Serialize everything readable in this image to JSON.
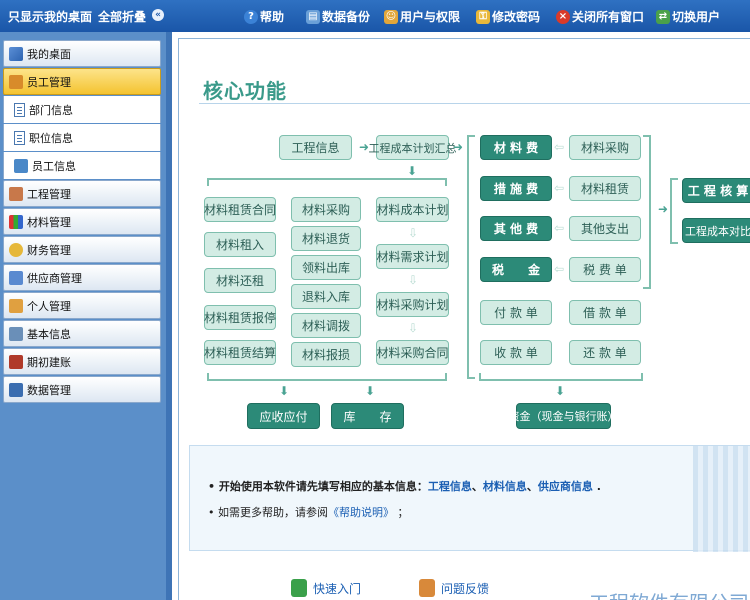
{
  "topbar": {
    "show_desktop": "只显示我的桌面",
    "collapse_all": "全部折叠",
    "help": "帮助",
    "backup": "数据备份",
    "users": "用户与权限",
    "password": "修改密码",
    "close_all": "关闭所有窗口",
    "switch_user": "切换用户"
  },
  "sidebar": {
    "items": [
      {
        "label": "我的桌面"
      },
      {
        "label": "员工管理"
      },
      {
        "label": "部门信息"
      },
      {
        "label": "职位信息"
      },
      {
        "label": "员工信息"
      },
      {
        "label": "工程管理"
      },
      {
        "label": "材料管理"
      },
      {
        "label": "财务管理"
      },
      {
        "label": "供应商管理"
      },
      {
        "label": "个人管理"
      },
      {
        "label": "基本信息"
      },
      {
        "label": "期初建账"
      },
      {
        "label": "数据管理"
      }
    ]
  },
  "main": {
    "title": "核心功能",
    "flow": {
      "project_info": "工程信息",
      "cost_plan_summary": "工程成本计划汇总",
      "left_col1": [
        "材料租赁合同",
        "材料租入",
        "材料还租",
        "材料租赁报停",
        "材料租赁结算"
      ],
      "left_col2": [
        "材料采购",
        "材料退货",
        "领料出库",
        "退料入库",
        "材料调拨",
        "材料报损"
      ],
      "left_col3": [
        "材料成本计划",
        "材料需求计划",
        "材料采购计划",
        "材料采购合同"
      ],
      "receivable": "应收应付",
      "inventory": "库　　存",
      "dark_col": [
        "材 料 费",
        "措 施 费",
        "其 他 费",
        "税　　金"
      ],
      "light_col": [
        "材料采购",
        "材料租赁",
        "其他支出",
        "税 费 单"
      ],
      "pay": "付 款 单",
      "borrow": "借 款 单",
      "collect": "收 款 单",
      "repay": "还 款 单",
      "funds": "资金（现金与银行账）",
      "accounting": "工 程 核 算",
      "cost_compare": "工程成本对比"
    },
    "info": {
      "line1_prefix": "开始使用本软件请先填写相应的基本信息：",
      "link1": "工程信息",
      "sep1": "、",
      "link2": "材料信息",
      "sep2": "、",
      "link3": "供应商信息",
      "line1_suffix": ".",
      "line2_prefix": "如需更多帮助，请参阅",
      "link4": "《帮助说明》",
      "line2_suffix": "；"
    },
    "quick_start": "快速入门",
    "feedback": "问题反馈",
    "company": "工程软件有限公司"
  }
}
